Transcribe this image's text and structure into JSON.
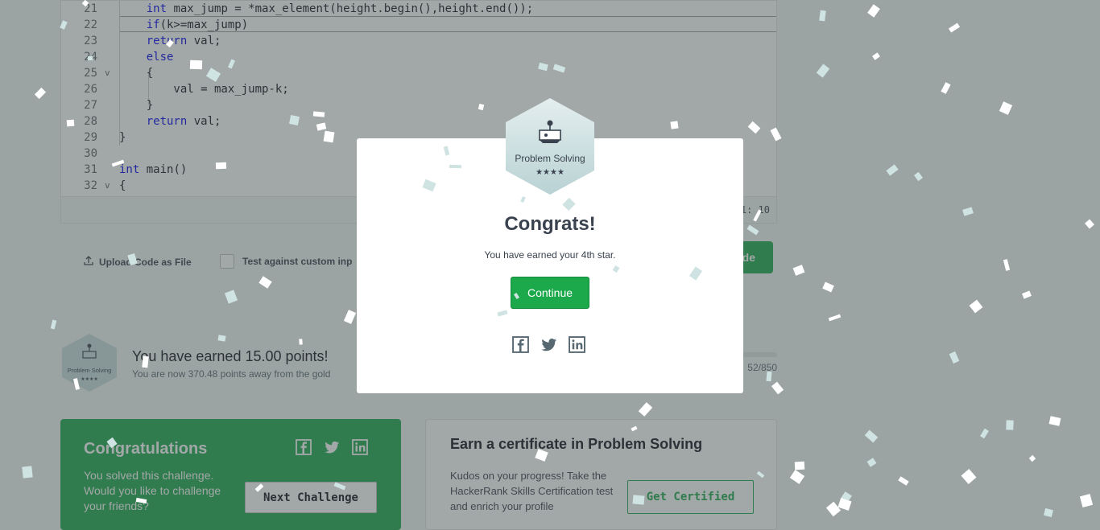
{
  "editor": {
    "lines": [
      {
        "num": "21",
        "fold": "",
        "parts": [
          {
            "t": "    "
          },
          {
            "t": "int",
            "k": true
          },
          {
            "t": " max_jump = *max_element(height.begin(),height.end());"
          }
        ]
      },
      {
        "num": "22",
        "fold": "",
        "parts": [
          {
            "t": "    "
          },
          {
            "t": "if",
            "k": true
          },
          {
            "t": "(k>=max_jump)"
          }
        ]
      },
      {
        "num": "23",
        "fold": "",
        "parts": [
          {
            "t": "    "
          },
          {
            "t": "return",
            "k": true
          },
          {
            "t": " val;"
          }
        ]
      },
      {
        "num": "24",
        "fold": "",
        "parts": [
          {
            "t": "    "
          },
          {
            "t": "else",
            "k": true
          }
        ]
      },
      {
        "num": "25",
        "fold": "v",
        "parts": [
          {
            "t": "    {"
          }
        ]
      },
      {
        "num": "26",
        "fold": "",
        "parts": [
          {
            "t": "        val = max_jump-k;"
          }
        ]
      },
      {
        "num": "27",
        "fold": "",
        "parts": [
          {
            "t": "    }"
          }
        ]
      },
      {
        "num": "28",
        "fold": "",
        "parts": [
          {
            "t": "    "
          },
          {
            "t": "return",
            "k": true
          },
          {
            "t": " val;"
          }
        ]
      },
      {
        "num": "29",
        "fold": "",
        "parts": [
          {
            "t": "}"
          }
        ]
      },
      {
        "num": "30",
        "fold": "",
        "parts": [
          {
            "t": ""
          }
        ]
      },
      {
        "num": "31",
        "fold": "",
        "parts": [
          {
            "t": "int",
            "k": true
          },
          {
            "t": " main()"
          }
        ]
      },
      {
        "num": "32",
        "fold": "v",
        "parts": [
          {
            "t": "{"
          }
        ]
      }
    ],
    "status_text": "1: 10"
  },
  "toolbar": {
    "upload_label": "Upload Code as File",
    "custom_label": "Test against custom inp",
    "submit_label": "de"
  },
  "points": {
    "title": "You have earned 15.00 points!",
    "subtitle": "You are now 370.48 points away from the gold",
    "progress_text": "52/850",
    "progress_fraction": 0.56
  },
  "badge": {
    "label": "Problem Solving",
    "stars": "★★★★"
  },
  "congrats_card": {
    "title": "Congratulations",
    "text": "You solved this challenge. Would you like to challenge your friends?",
    "next_label": "Next Challenge"
  },
  "cert_card": {
    "title": "Earn a certificate in Problem Solving",
    "text": "Kudos on your progress! Take the HackerRank Skills Certification test and enrich your profile",
    "button_label": "Get Certified"
  },
  "modal": {
    "title": "Congrats!",
    "subtitle": "You have earned your 4th star.",
    "continue_label": "Continue"
  },
  "colors": {
    "accent_green": "#1ba94c",
    "keyword_blue": "#0000ee",
    "badge_teal": "#c9dedf",
    "confetti": "#cfe3e3"
  },
  "icons": [
    "upload-icon",
    "facebook-icon",
    "twitter-icon",
    "linkedin-icon",
    "joystick-icon"
  ]
}
